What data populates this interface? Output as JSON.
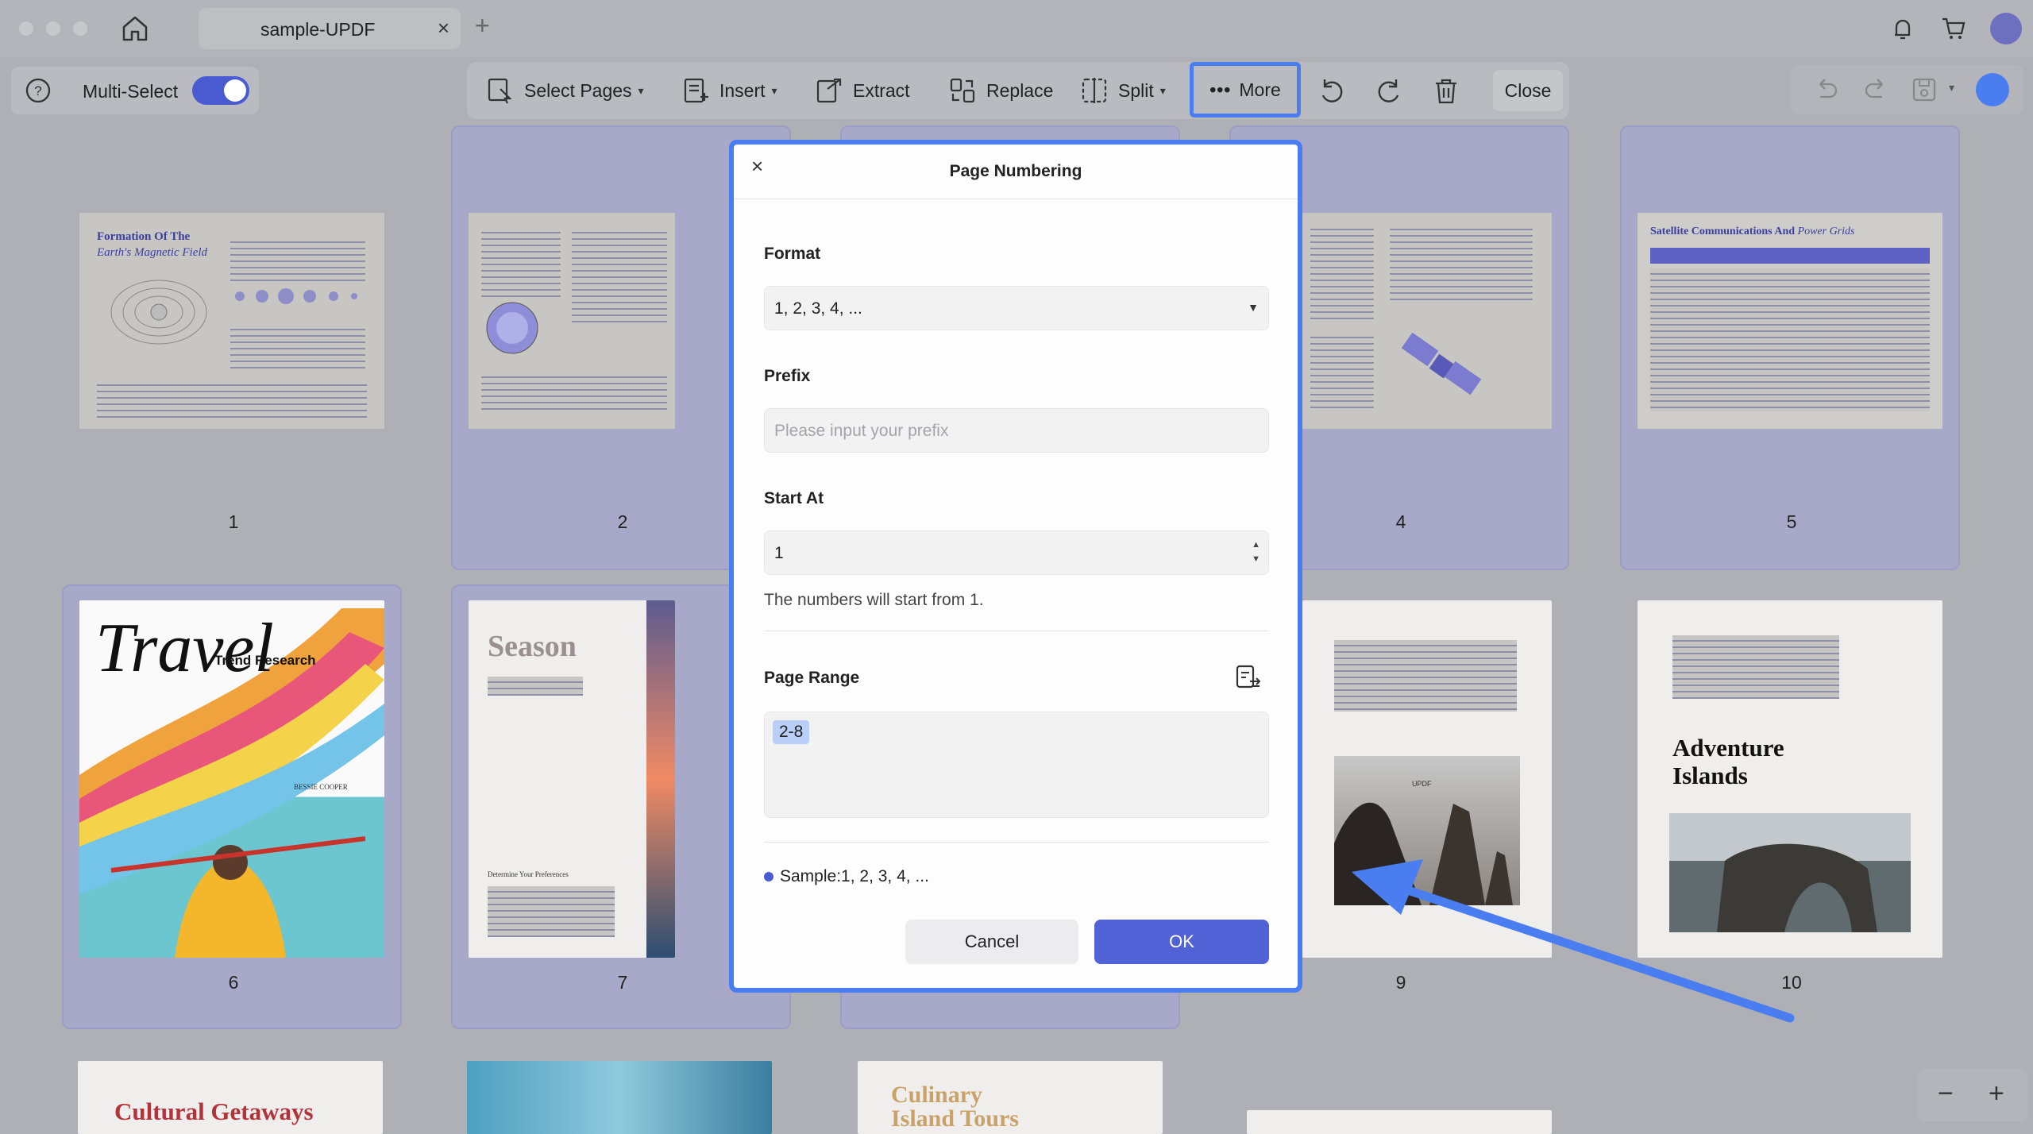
{
  "window": {
    "tab_title": "sample-UPDF"
  },
  "toolbar": {
    "multi_select_label": "Multi-Select",
    "select_pages_label": "Select Pages",
    "insert_label": "Insert",
    "extract_label": "Extract",
    "replace_label": "Replace",
    "split_label": "Split",
    "more_label": "More",
    "close_label": "Close"
  },
  "pages": {
    "numbers": [
      "1",
      "2",
      "4",
      "5",
      "6",
      "7",
      "9",
      "10"
    ],
    "thumb_titles": {
      "p1_title1": "Formation Of The",
      "p1_title2": "Earth's Magnetic Field",
      "p5_title1": "Satellite Communications And",
      "p5_title2": "Power Grids",
      "p6_script": "Travel",
      "p6_label": "Trend Research",
      "p6_author": "BESSIE COOPER",
      "p7_title": "Season",
      "p7_sub": "Determine Your Preferences",
      "p9_logo": "UPDF",
      "p10_title1": "Adventure",
      "p10_title2": "Islands",
      "p11_title": "Cultural Getaways",
      "p13_title1": "Culinary",
      "p13_title2": "Island Tours"
    }
  },
  "dialog": {
    "title": "Page Numbering",
    "format_label": "Format",
    "format_value": "1, 2, 3, 4, ...",
    "prefix_label": "Prefix",
    "prefix_placeholder": "Please input your prefix",
    "start_label": "Start At",
    "start_value": "1",
    "start_hint": "The numbers will start from 1.",
    "range_label": "Page Range",
    "range_value": "2-8",
    "sample_text": "Sample:1, 2, 3, 4, ...",
    "cancel_label": "Cancel",
    "ok_label": "OK"
  },
  "colors": {
    "accent": "#4a7ef0",
    "primary_button": "#5161d6",
    "selected_card": "#a8a9c8"
  }
}
